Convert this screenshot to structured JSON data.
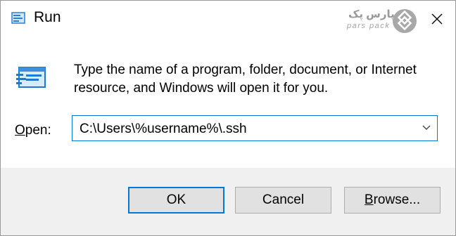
{
  "window": {
    "title": "Run",
    "icon": "run-icon",
    "close_icon": "close-icon"
  },
  "watermark": {
    "persian": "پارس پک",
    "english": "pars pack",
    "logo_icon": "parspack-logo-icon"
  },
  "content": {
    "icon": "run-large-icon",
    "description_line1": "Type the name of a program, folder, document, or Internet",
    "description_line2": "resource, and Windows will open it for you.",
    "open_label_mnemonic": "O",
    "open_label_rest": "pen:",
    "open_value": "C:\\Users\\%username%\\.ssh",
    "dropdown_icon": "chevron-down-icon"
  },
  "buttons": {
    "ok": "OK",
    "cancel": "Cancel",
    "browse_mnemonic": "B",
    "browse_rest": "rowse..."
  },
  "colors": {
    "accent": "#0078d7",
    "footer_bg": "#f0f0f0",
    "button_bg": "#e1e1e1",
    "button_border": "#adadad"
  }
}
